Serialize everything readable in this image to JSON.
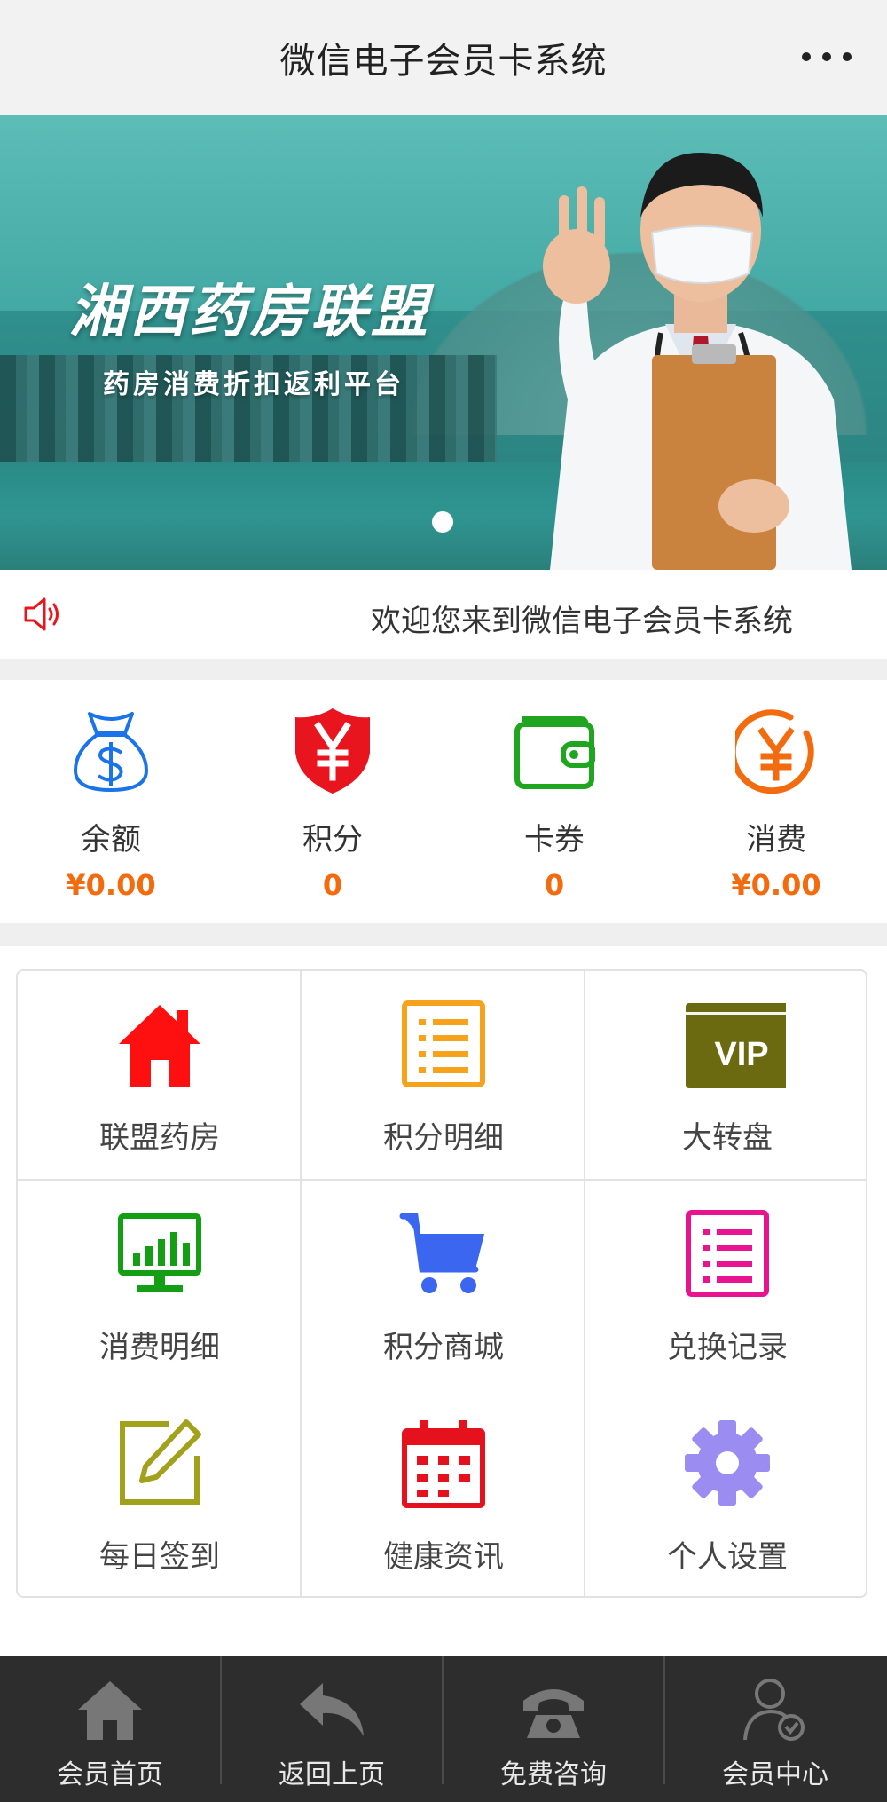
{
  "header": {
    "title": "微信电子会员卡系统",
    "more_icon": "more-icon"
  },
  "banner": {
    "headline": "湘西药房联盟",
    "subline": "药房消费折扣返利平台",
    "slide_count": 1
  },
  "notice": {
    "text": "欢迎您来到微信电子会员卡系统"
  },
  "stats": [
    {
      "label": "余额",
      "value": "¥0.00",
      "icon": "money-bag-icon",
      "color": "#1a73e8"
    },
    {
      "label": "积分",
      "value": "0",
      "icon": "yen-shield-icon",
      "color": "#e8141e"
    },
    {
      "label": "卡券",
      "value": "0",
      "icon": "wallet-icon",
      "color": "#1fa51f"
    },
    {
      "label": "消费",
      "value": "¥0.00",
      "icon": "yen-circle-icon",
      "color": "#f36b0f"
    }
  ],
  "grid": [
    {
      "label": "联盟药房",
      "icon": "home-icon",
      "color": "#ff1010"
    },
    {
      "label": "积分明细",
      "icon": "list-icon",
      "color": "#f7a21b"
    },
    {
      "label": "大转盘",
      "icon": "vip-icon",
      "color": "#6b6a10"
    },
    {
      "label": "消费明细",
      "icon": "monitor-chart-icon",
      "color": "#149e14"
    },
    {
      "label": "积分商城",
      "icon": "cart-icon",
      "color": "#3a66f0"
    },
    {
      "label": "兑换记录",
      "icon": "record-list-icon",
      "color": "#e8148f"
    },
    {
      "label": "每日签到",
      "icon": "edit-icon",
      "color": "#a1a11c"
    },
    {
      "label": "健康资讯",
      "icon": "calendar-icon",
      "color": "#e5121e"
    },
    {
      "label": "个人设置",
      "icon": "gear-icon",
      "color": "#9b8cf2"
    }
  ],
  "bottom_nav": [
    {
      "label": "会员首页",
      "icon": "home-outline-icon"
    },
    {
      "label": "返回上页",
      "icon": "reply-all-icon"
    },
    {
      "label": "免费咨询",
      "icon": "phone-icon"
    },
    {
      "label": "会员中心",
      "icon": "user-check-icon"
    }
  ],
  "colors": {
    "header_bg": "#f2f2f2",
    "stat_value": "#f36b0f",
    "bottom_bg": "#2d2d2d"
  }
}
